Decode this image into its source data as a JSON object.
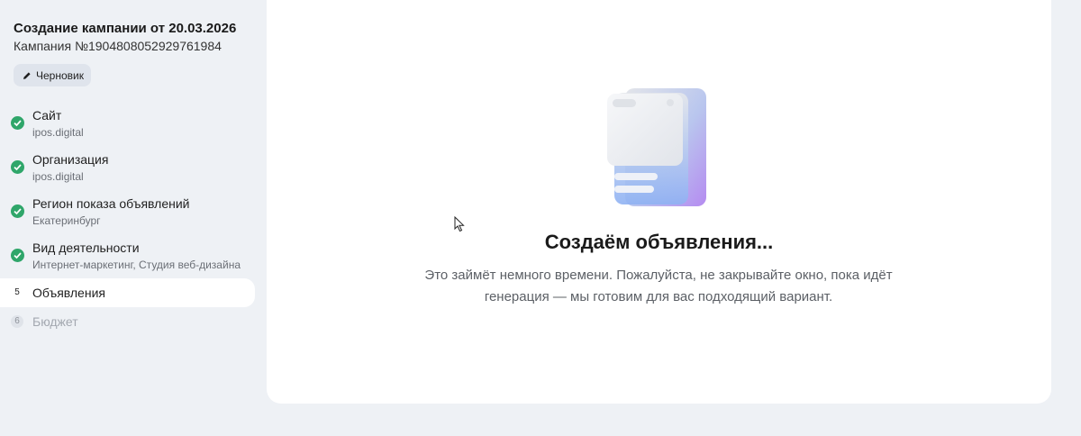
{
  "sidebar": {
    "title": "Создание кампании от 20.03.2026",
    "campaign_number": "Кампания №1904808052929761984",
    "draft_badge": {
      "label": "Черновик",
      "icon": "pencil-icon"
    },
    "steps": [
      {
        "status": "done",
        "label": "Сайт",
        "sub": "ipos.digital",
        "icon": "check-circle-icon"
      },
      {
        "status": "done",
        "label": "Организация",
        "sub": "ipos.digital",
        "icon": "check-circle-icon"
      },
      {
        "status": "done",
        "label": "Регион показа объявлений",
        "sub": "Екатеринбург",
        "icon": "check-circle-icon"
      },
      {
        "status": "done",
        "label": "Вид деятельности",
        "sub": "Интернет-маркетинг, Студия веб-дизайна",
        "icon": "check-circle-icon"
      },
      {
        "status": "active",
        "number": "5",
        "label": "Объявления"
      },
      {
        "status": "disabled",
        "number": "6",
        "label": "Бюджет"
      }
    ]
  },
  "main": {
    "illustration": "document-stack-illustration",
    "title": "Создаём объявления...",
    "description_line1": "Это займёт немного времени. Пожалуйста, не закрывайте окно, пока идёт",
    "description_line2": "генерация — мы готовим для вас подходящий вариант."
  },
  "colors": {
    "background": "#eef1f5",
    "panel": "#ffffff",
    "success": "#2fa66a",
    "muted_text": "#6b6f76"
  }
}
